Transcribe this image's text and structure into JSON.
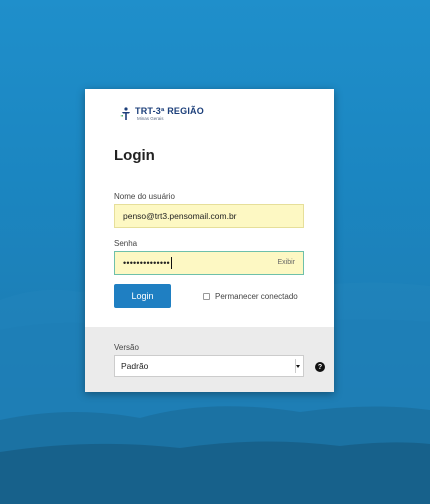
{
  "login": {
    "logo_title": "TRT-3ª REGIÃO",
    "logo_subtitle": "Minas Gerais",
    "title": "Login",
    "username_label": "Nome do usuário",
    "username_value": "penso@trt3.pensomail.com.br",
    "password_label": "Senha",
    "password_masked": "••••••••••••••",
    "show_password_label": "Exibir",
    "login_button": "Login",
    "remember_label": "Permanecer conectado"
  },
  "footer": {
    "version_label": "Versão",
    "version_selected": "Padrão",
    "help_icon": "question-circle-icon"
  },
  "colors": {
    "background": "#1f8fcb",
    "button": "#1f7fc2",
    "input_autofill": "#fdf8c3",
    "footer_bg": "#ebebeb"
  }
}
